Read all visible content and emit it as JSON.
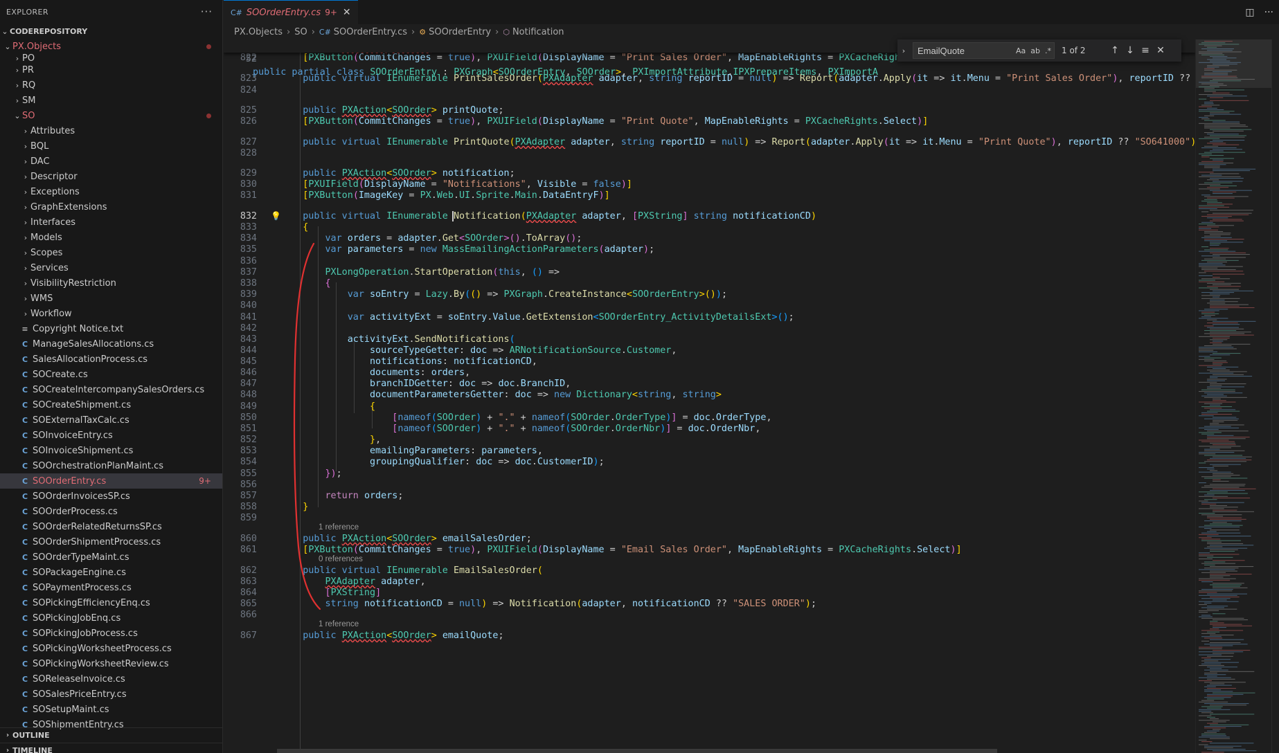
{
  "sidebar": {
    "title": "EXPLORER",
    "more": "···",
    "repo": "CODEREPOSITORY",
    "project": "PX.Objects",
    "top_folder_partial": "PO",
    "folders_top": [
      "PR",
      "RQ",
      "SM"
    ],
    "so_folder": "SO",
    "so_subfolders": [
      "Attributes",
      "BQL",
      "DAC",
      "Descriptor",
      "Exceptions",
      "GraphExtensions",
      "Interfaces",
      "Models",
      "Scopes",
      "Services",
      "VisibilityRestriction",
      "WMS",
      "Workflow"
    ],
    "files": [
      "Copyright Notice.txt",
      "ManageSalesAllocations.cs",
      "SalesAllocationProcess.cs",
      "SOCreate.cs",
      "SOCreateIntercompanySalesOrders.cs",
      "SOCreateShipment.cs",
      "SOExternalTaxCalc.cs",
      "SOInvoiceEntry.cs",
      "SOInvoiceShipment.cs",
      "SOOrchestrationPlanMaint.cs",
      "SOOrderEntry.cs",
      "SOOrderInvoicesSP.cs",
      "SOOrderProcess.cs",
      "SOOrderRelatedReturnsSP.cs",
      "SOOrderShipmentProcess.cs",
      "SOOrderTypeMaint.cs",
      "SOPackageEngine.cs",
      "SOPaymentProcess.cs",
      "SOPickingEfficiencyEnq.cs",
      "SOPickingJobEnq.cs",
      "SOPickingJobProcess.cs",
      "SOPickingWorksheetProcess.cs",
      "SOPickingWorksheetReview.cs",
      "SOReleaseInvoice.cs",
      "SOSalesPriceEntry.cs",
      "SOSetupMaint.cs",
      "SOShipmentEntry.cs"
    ],
    "selected_file": "SOOrderEntry.cs",
    "selected_badge": "9+",
    "outline": "OUTLINE",
    "timeline": "TIMELINE"
  },
  "tab": {
    "label": "SOOrderEntry.cs",
    "badge": "9+",
    "close": "✕"
  },
  "breadcrumb": {
    "items": [
      "PX.Objects",
      "SO",
      "SOOrderEntry.cs",
      "SOOrderEntry",
      "Notification"
    ]
  },
  "find": {
    "query": "EmailQuote",
    "opt_case": "Aa",
    "opt_word": "ab",
    "opt_regex": ".*",
    "count": "1 of 2"
  },
  "codelens": {
    "ref_one": "1 reference",
    "ref_zero": "0 references"
  },
  "line_numbers": {
    "sticky": "52",
    "first": 821,
    "last": 867,
    "active": 832
  },
  "colors": {
    "accent": "#0078d4",
    "error": "#e06c75",
    "annotation": "#e03131"
  }
}
